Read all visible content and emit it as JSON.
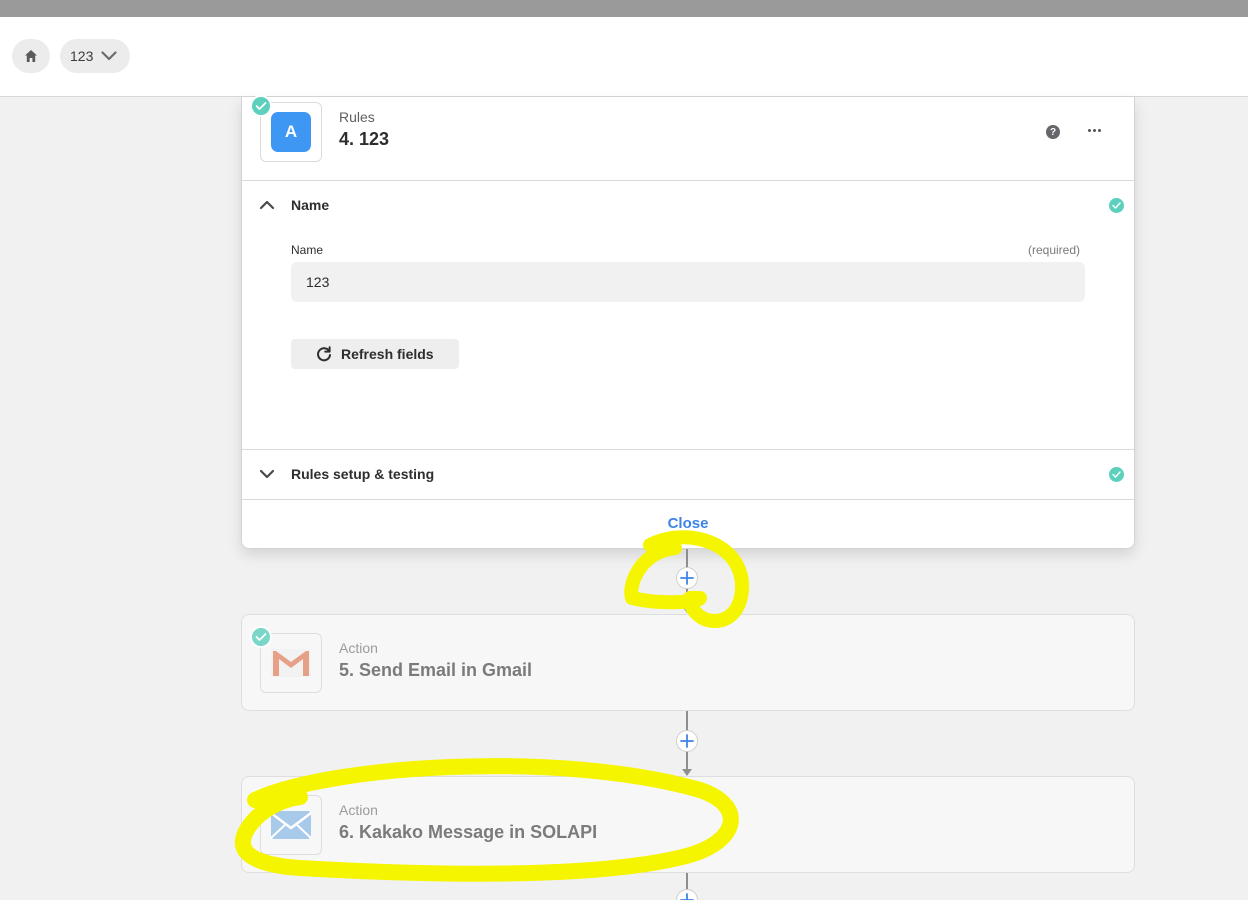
{
  "header": {
    "home_icon": "home-icon",
    "breadcrumb_label": "123",
    "breadcrumb_icon": "chevron-down-icon"
  },
  "current_step": {
    "kind": "Rules",
    "title": "4. 123",
    "app_letter": "A",
    "app_color": "#3d97f3",
    "help_icon": "question-circle-icon",
    "more_icon": "more-horizontal-icon",
    "sections": [
      {
        "title": "Name",
        "expanded": true,
        "complete": true,
        "field": {
          "label": "Name",
          "required_text": "(required)",
          "value": "123"
        },
        "refresh_label": "Refresh fields"
      },
      {
        "title": "Rules setup & testing",
        "expanded": false,
        "complete": true
      }
    ],
    "close_label": "Close"
  },
  "steps": [
    {
      "kind": "Action",
      "title": "5. Send Email in Gmail",
      "icon": "gmail-icon",
      "complete": true
    },
    {
      "kind": "Action",
      "title": "6. Kakako Message in SOLAPI",
      "icon": "solapi-message-icon",
      "complete": true
    }
  ],
  "colors": {
    "accent": "#3d84e6",
    "success": "#5cd0bd",
    "highlight": "#f5f500"
  }
}
